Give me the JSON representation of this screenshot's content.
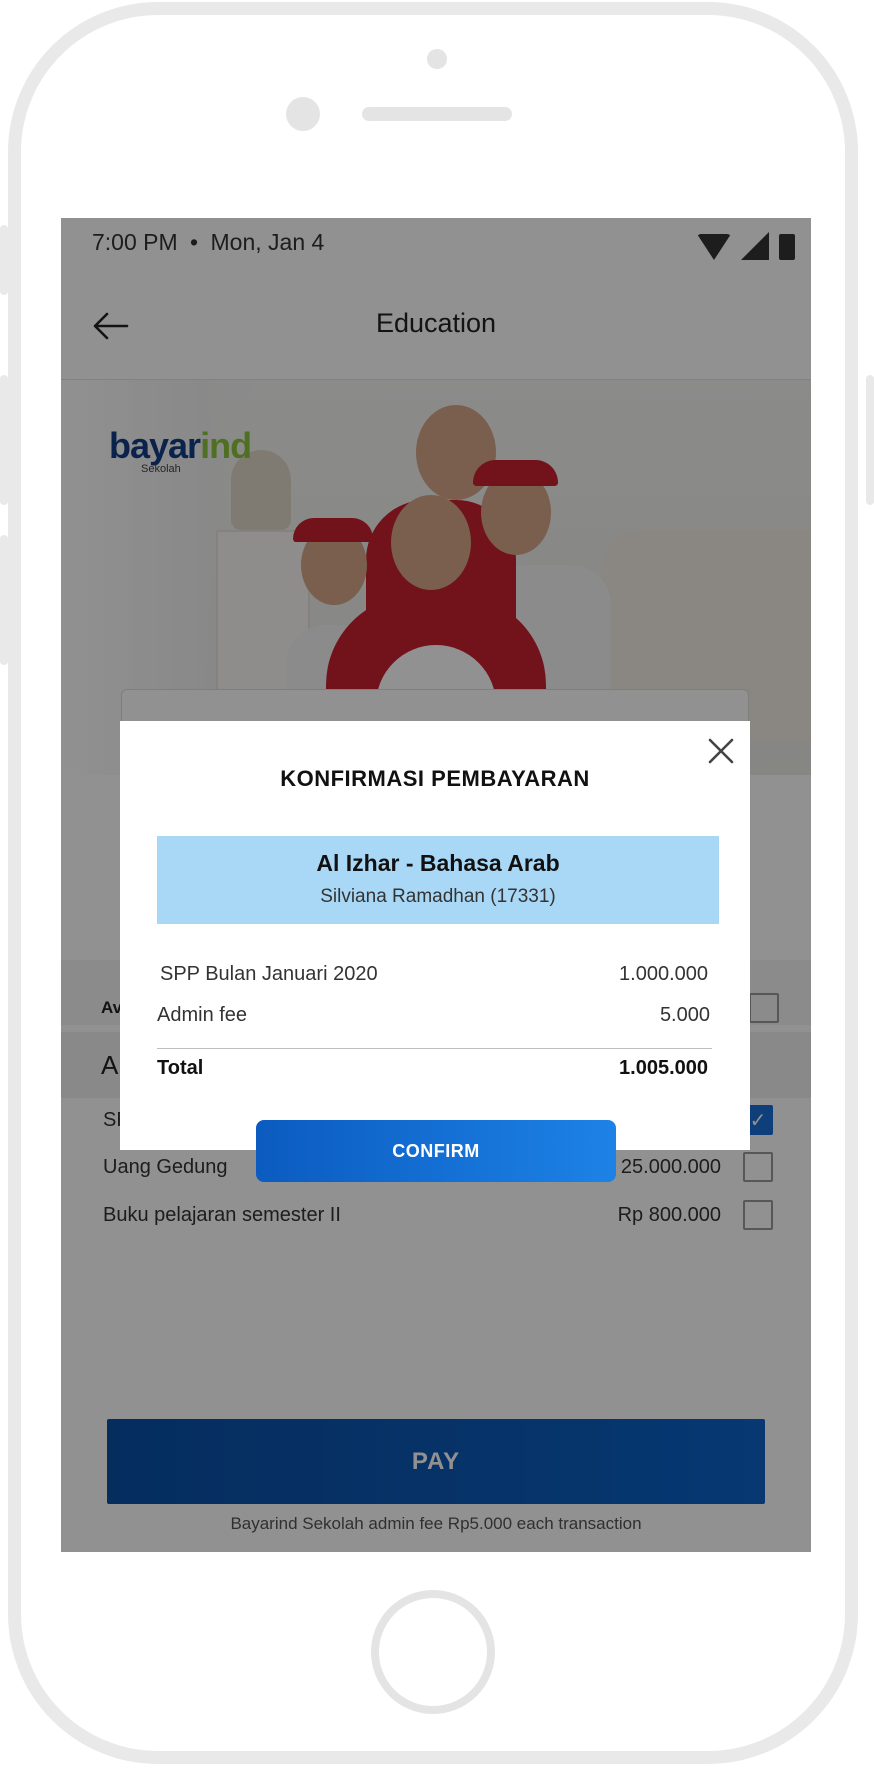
{
  "status_bar": {
    "time": "7:00 PM",
    "separator": "•",
    "date": "Mon, Jan 4",
    "icons": [
      "wifi-icon",
      "signal-icon",
      "battery-icon"
    ]
  },
  "header": {
    "title": "Education",
    "back_icon": "arrow-left-icon"
  },
  "hero": {
    "brand_main": "bayar",
    "brand_accent": "ind",
    "brand_sub": "Sekolah"
  },
  "background_page": {
    "available_label_visible": "Av",
    "section_label_visible": "A",
    "bills": [
      {
        "name": "SP",
        "amount": "",
        "checked": true
      },
      {
        "name": "Uang Gedung",
        "amount": "25.000.000",
        "checked": false
      },
      {
        "name": "Buku pelajaran semester II",
        "amount": "Rp 800.000",
        "checked": false
      }
    ],
    "pay_label": "PAY",
    "fee_note": "Bayarind Sekolah admin fee Rp5.000 each transaction"
  },
  "modal": {
    "title": "KONFIRMASI PEMBAYARAN",
    "close_icon": "close-icon",
    "school_name": "Al Izhar - Bahasa Arab",
    "student": "Silviana Ramadhan (17331)",
    "items": [
      {
        "label": "SPP Bulan Januari 2020",
        "value": "1.000.000"
      },
      {
        "label": "Admin fee",
        "value": "5.000"
      }
    ],
    "total_label": "Total",
    "total_value": "1.005.000",
    "confirm_label": "CONFIRM"
  },
  "colors": {
    "brand_blue": "#153f86",
    "brand_green": "#8cc63f",
    "info_box": "#a9d8f7",
    "button_blue": "#0d63c8",
    "overlay": "rgba(0,0,0,0.43)"
  }
}
